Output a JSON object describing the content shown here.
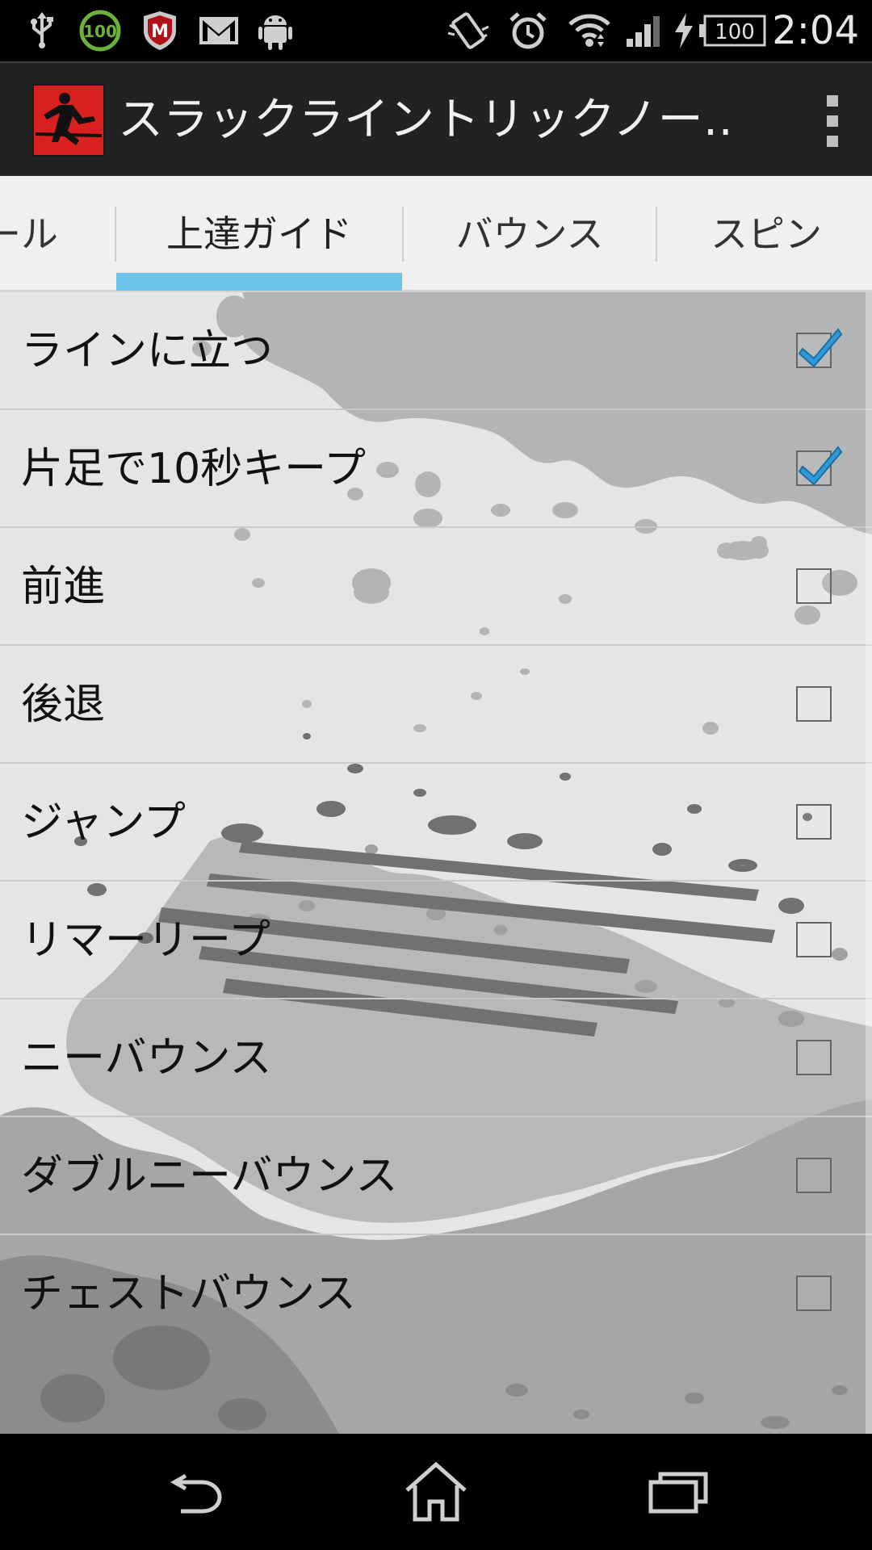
{
  "status_bar": {
    "time": "2:04",
    "battery_level": "100",
    "notification_badge": "100",
    "icons": [
      "usb-icon",
      "battery-saver-badge-icon",
      "mcafee-icon",
      "gmail-icon",
      "android-icon",
      "vibrate-icon",
      "alarm-icon",
      "wifi-icon",
      "signal-icon",
      "charging-icon",
      "battery-icon"
    ]
  },
  "action_bar": {
    "title": "スラックライントリックノー…",
    "icons": [
      "app-logo-icon",
      "overflow-menu-icon"
    ]
  },
  "tabs": [
    {
      "label": "ール",
      "selected": false
    },
    {
      "label": "上達ガイド",
      "selected": true
    },
    {
      "label": "バウンス",
      "selected": false
    },
    {
      "label": "スピン",
      "selected": false
    }
  ],
  "list": {
    "items": [
      {
        "label": "ラインに立つ",
        "checked": true
      },
      {
        "label": "片足で10秒キープ",
        "checked": true
      },
      {
        "label": "前進",
        "checked": false
      },
      {
        "label": "後退",
        "checked": false
      },
      {
        "label": "ジャンプ",
        "checked": false
      },
      {
        "label": "リマーリープ",
        "checked": false
      },
      {
        "label": "ニーバウンス",
        "checked": false
      },
      {
        "label": "ダブルニーバウンス",
        "checked": false
      },
      {
        "label": "チェストバウンス",
        "checked": false
      }
    ]
  },
  "nav_bar": {
    "icons": [
      "back-icon",
      "home-icon",
      "recent-apps-icon"
    ]
  },
  "colors": {
    "tab_indicator": "#6ec3ea",
    "check_mark": "#2f9ad6",
    "app_icon_red": "#d9201e"
  }
}
